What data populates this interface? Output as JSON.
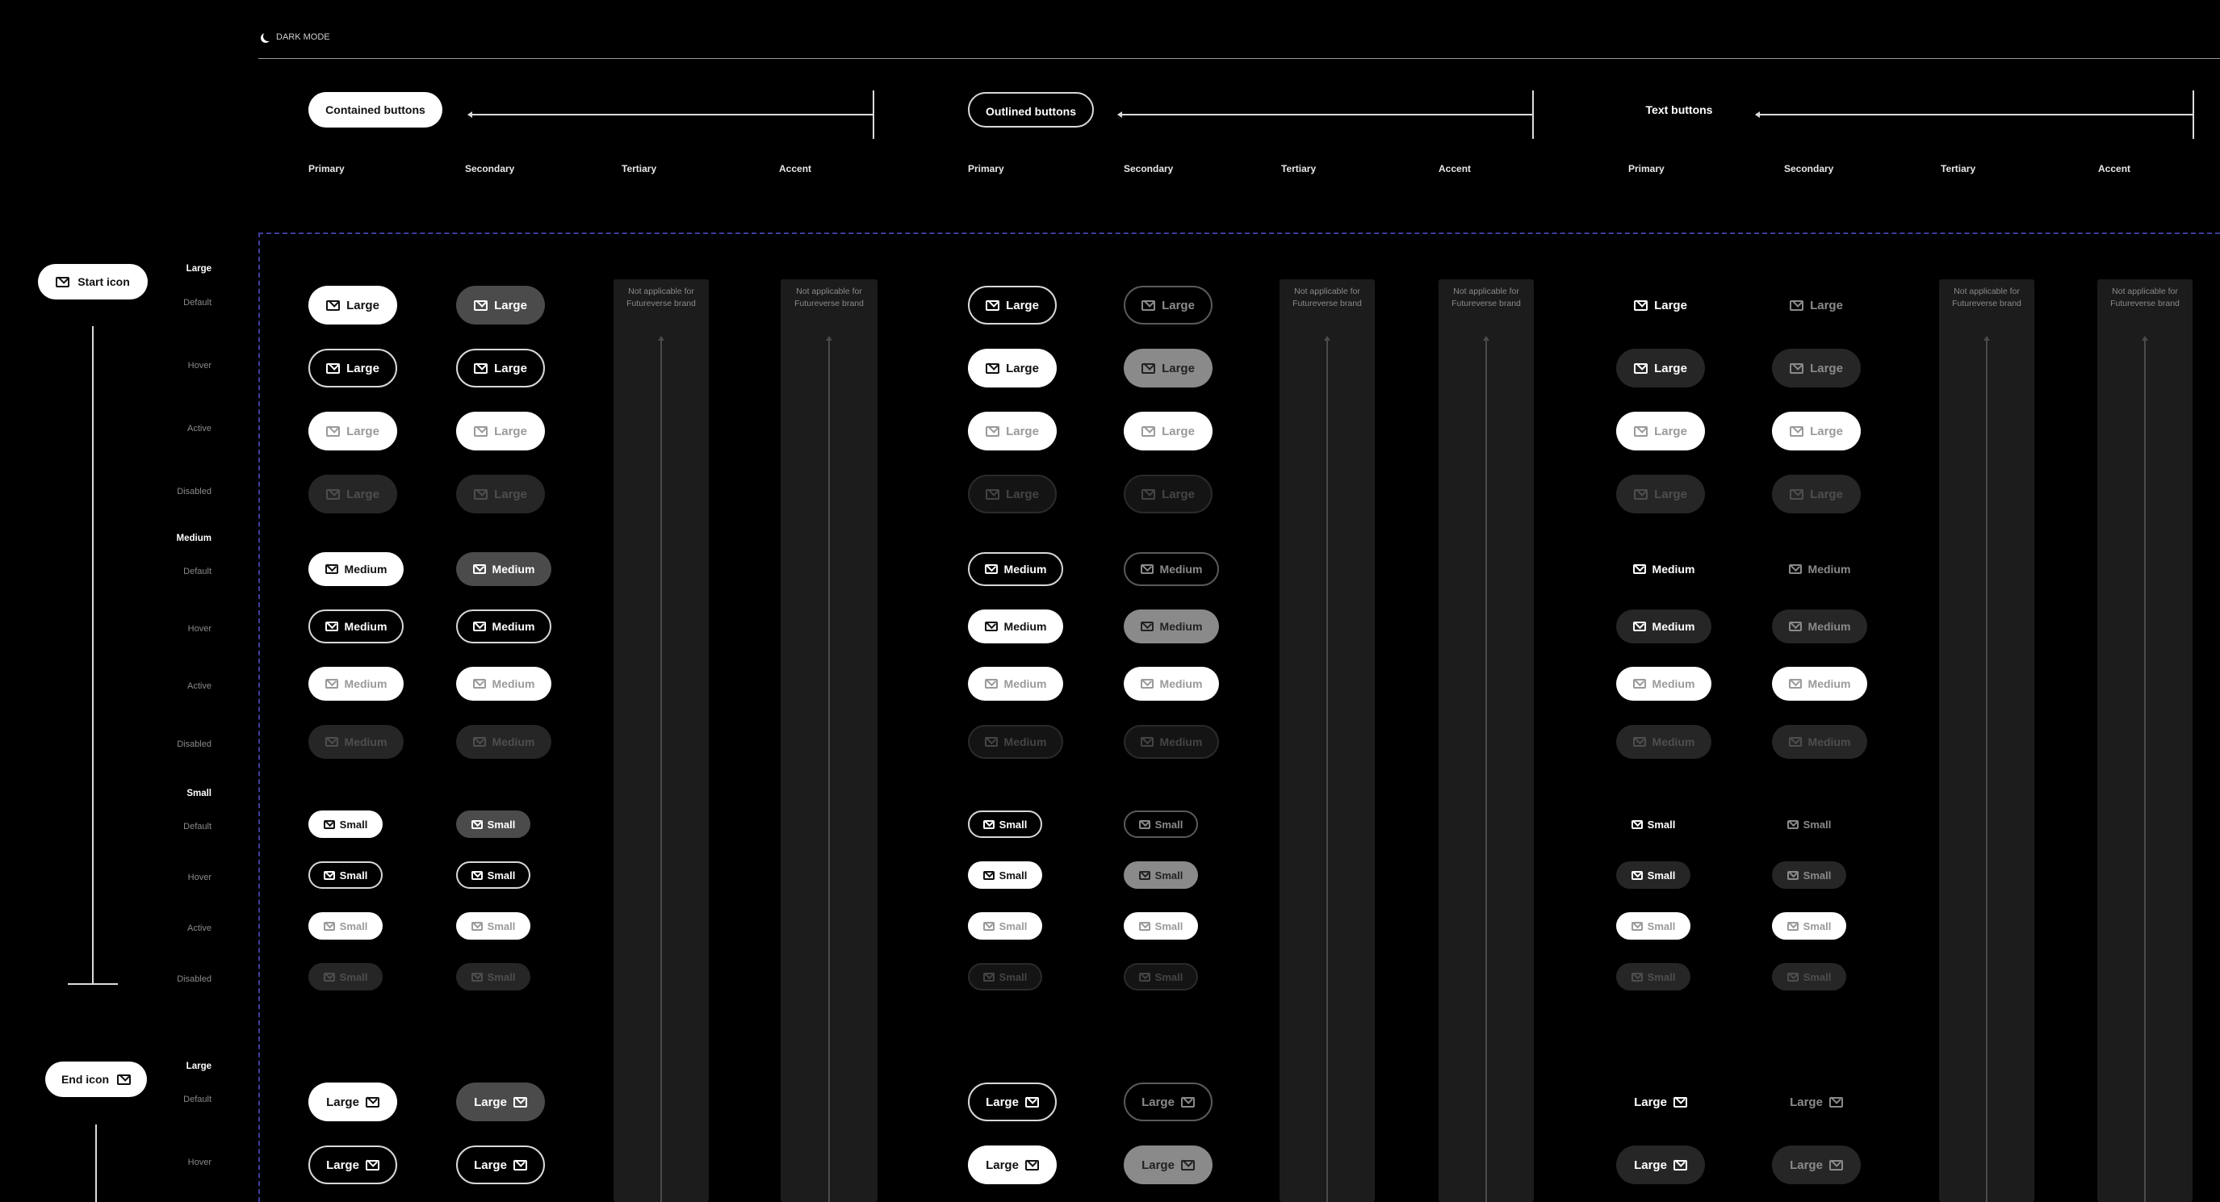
{
  "header": {
    "mode_label": "DARK MODE"
  },
  "groups": [
    {
      "title": "Contained buttons"
    },
    {
      "title": "Outlined buttons"
    },
    {
      "title": "Text buttons"
    }
  ],
  "columns": [
    "Primary",
    "Secondary",
    "Tertiary",
    "Accent"
  ],
  "not_applicable": "Not applicable for Futureverse brand",
  "sections": [
    {
      "title": "Start icon"
    },
    {
      "title": "End icon"
    }
  ],
  "sizes": {
    "large": "Large",
    "medium": "Medium",
    "small": "Small"
  },
  "states": {
    "default": "Default",
    "hover": "Hover",
    "active": "Active",
    "disabled": "Disabled"
  },
  "icons": {
    "button_icon": "envelope-icon",
    "mode_icon": "moon-icon"
  }
}
